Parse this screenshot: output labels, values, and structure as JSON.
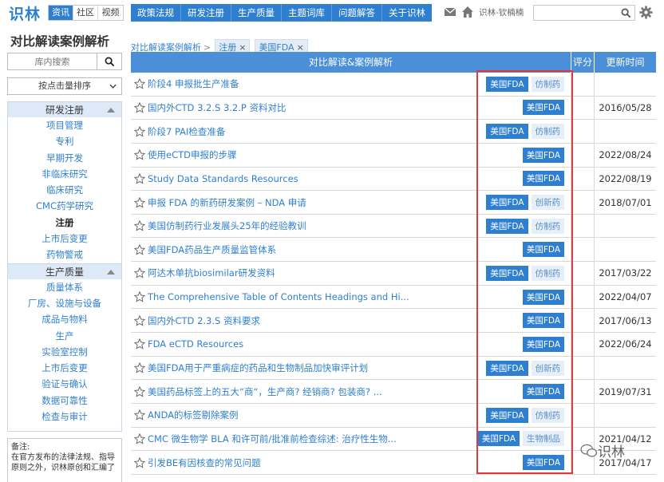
{
  "app": {
    "logo_text": "识林"
  },
  "site_tabs": [
    "资讯",
    "社区",
    "视频"
  ],
  "main_nav": [
    "政策法规",
    "研发注册",
    "生产质量",
    "主题词库",
    "问题解答",
    "关于识林"
  ],
  "header": {
    "username": "识林-钦楠楠",
    "search_value": ""
  },
  "sidebar": {
    "title": "对比解读案例解析",
    "search_placeholder": "库内搜索",
    "sort_label": "按点击量排序",
    "groups": [
      {
        "label": "研发注册",
        "items": [
          "项目管理",
          "专利",
          "早期开发",
          "非临床研究",
          "临床研究",
          "CMC药学研究",
          "注册",
          "上市后变更",
          "药物警戒"
        ]
      },
      {
        "label": "生产质量",
        "items": [
          "质量体系",
          "厂房、设施与设备",
          "成品与物料",
          "生产",
          "实验室控制",
          "上市后变更",
          "验证与确认",
          "数据可靠性",
          "检查与审计"
        ]
      }
    ],
    "active_item": "注册",
    "note_label": "备注:",
    "note_text": "在官方发布的法律法规、指导原则之外，识林原创和汇编了"
  },
  "breadcrumb": {
    "root": "对比解读案例解析",
    "sep": ">",
    "chips": [
      "注册",
      "美国FDA"
    ],
    "chip_close": "×"
  },
  "table": {
    "headers": [
      "对比解读&案例解析",
      "评分",
      "更新时间"
    ],
    "rows": [
      {
        "title": "阶段4 申报批生产准备",
        "tags": [
          "美国FDA",
          "仿制药"
        ],
        "date": ""
      },
      {
        "title": "国内外CTD 3.2.S 3.2.P 资料对比",
        "tags": [
          "美国FDA"
        ],
        "date": "2016/05/28"
      },
      {
        "title": "阶段7 PAI检查准备",
        "tags": [
          "美国FDA",
          "仿制药"
        ],
        "date": ""
      },
      {
        "title": "使用eCTD申报的步骤",
        "tags": [
          "美国FDA"
        ],
        "date": "2022/08/24"
      },
      {
        "title": "Study Data Standards Resources",
        "tags": [
          "美国FDA"
        ],
        "date": "2022/08/19"
      },
      {
        "title": "申报 FDA 的新药研发案例 – NDA 申请",
        "tags": [
          "美国FDA",
          "创新药"
        ],
        "date": "2018/07/01"
      },
      {
        "title": "美国仿制药行业发展头25年的经验教训",
        "tags": [
          "美国FDA",
          "仿制药"
        ],
        "date": ""
      },
      {
        "title": "美国FDA药品生产质量监管体系",
        "tags": [
          "美国FDA"
        ],
        "date": ""
      },
      {
        "title": "阿达木单抗biosimilar研发资料",
        "tags": [
          "美国FDA",
          "仿制药"
        ],
        "date": "2017/03/22"
      },
      {
        "title": "The Comprehensive Table of Contents Headings and Hi...",
        "tags": [
          "美国FDA"
        ],
        "date": "2022/04/07"
      },
      {
        "title": "国内外CTD 2.3.S 资料要求",
        "tags": [
          "美国FDA"
        ],
        "date": "2017/06/13"
      },
      {
        "title": "FDA eCTD Resources",
        "tags": [
          "美国FDA"
        ],
        "date": "2022/06/24"
      },
      {
        "title": "美国FDA用于严重病症的药品和生物制品加快审评计划",
        "tags": [
          "美国FDA",
          "创新药"
        ],
        "date": ""
      },
      {
        "title": "美国药品标签上的五大“商“，生产商? 经销商? 包装商? ...",
        "tags": [
          "美国FDA"
        ],
        "date": "2019/07/31"
      },
      {
        "title": "ANDA的标签剔除案例",
        "tags": [
          "美国FDA",
          "仿制药"
        ],
        "date": ""
      },
      {
        "title": "CMC 微生物学 BLA 和许可前/批准前检查综述: 治疗性生物...",
        "tags": [
          "美国FDA",
          "生物制品"
        ],
        "date": "2021/04/12"
      },
      {
        "title": "引发BE有因核查的常见问题",
        "tags": [
          "美国FDA"
        ],
        "date": "2017/04/17"
      }
    ]
  },
  "watermark": "识林",
  "colors": {
    "brand": "#2f7fd1",
    "header_bg": "#4a8fd8",
    "highlight": "#e23a3a"
  }
}
